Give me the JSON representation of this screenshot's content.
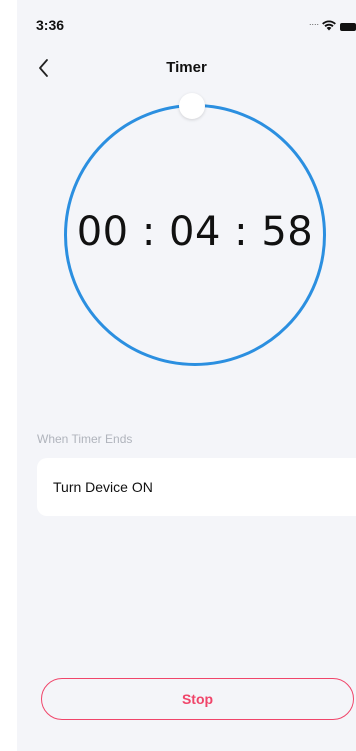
{
  "status_bar": {
    "time": "3:36",
    "signal_dots": "....",
    "wifi_icon": "wifi-icon",
    "battery_icon": "battery-icon"
  },
  "nav": {
    "back_icon": "chevron-left-icon",
    "title": "Timer"
  },
  "timer": {
    "remaining": "00 : 04 : 58",
    "accent_color": "#2b8fe0"
  },
  "when_ends": {
    "label": "When Timer Ends",
    "action": "Turn Device ON"
  },
  "stop_button": {
    "label": "Stop",
    "color": "#f0456a"
  }
}
